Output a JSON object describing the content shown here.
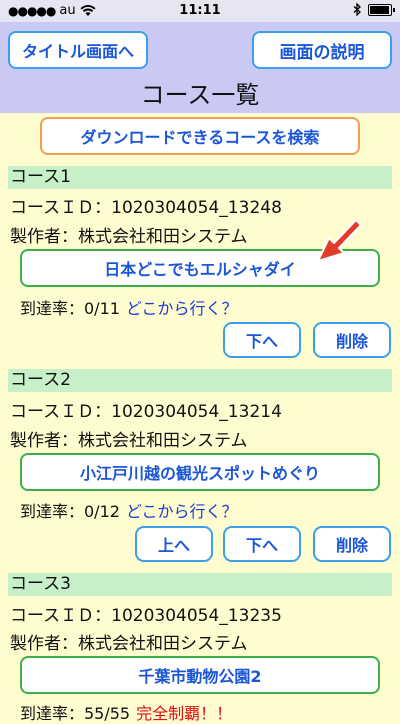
{
  "status_bar": {
    "carrier": "au",
    "time": "11:11"
  },
  "header": {
    "back_button": "タイトル画面へ",
    "help_button": "画面の説明",
    "title": "コース一覧"
  },
  "search_button": "ダウンロードできるコースを検索",
  "courses": [
    {
      "heading": "コース1",
      "id_line": "コースＩＤ：1020304054_13248",
      "maker_line": "製作者：株式会社和田システム",
      "name": "日本どこでもエルシャダイ",
      "progress": "到達率：0/11",
      "status": "どこから行く？",
      "buttons": {
        "down": "下へ",
        "delete": "削除"
      }
    },
    {
      "heading": "コース2",
      "id_line": "コースＩＤ：1020304054_13214",
      "maker_line": "製作者：株式会社和田システム",
      "name": "小江戸川越の観光スポットめぐり",
      "progress": "到達率：0/12",
      "status": "どこから行く？",
      "buttons": {
        "up": "上へ",
        "down": "下へ",
        "delete": "削除"
      }
    },
    {
      "heading": "コース3",
      "id_line": "コースＩＤ：1020304054_13235",
      "maker_line": "製作者：株式会社和田システム",
      "name": "千葉市動物公園2",
      "progress": "到達率：55/55",
      "status": "完全制覇！！"
    }
  ],
  "colors": {
    "accent": "#1a56d6",
    "header_bg": "#c9c9f3",
    "page_bg": "#fffdd0",
    "course_head_bg": "#c8f0c8",
    "arrow": "#e23b2a"
  }
}
